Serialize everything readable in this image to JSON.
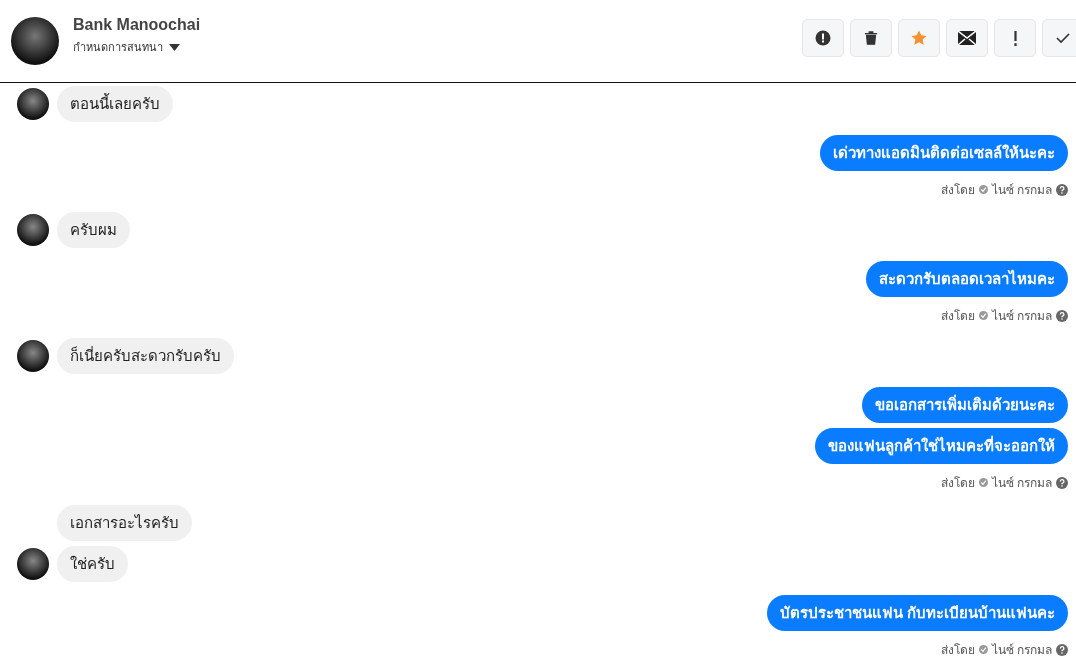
{
  "header": {
    "name": "Bank Manoochai",
    "menu_label": "กำหนดการสนทนา",
    "starred": true
  },
  "messages": [
    {
      "kind": "incoming",
      "bubbles": [
        "ตอนนี้เลยครับ"
      ]
    },
    {
      "kind": "outgoing",
      "bubbles": [
        "เด่วทางแอดมินติดต่อเซลล์ให้นะคะ"
      ],
      "sent_prefix": "ส่งโดย",
      "sender": "ไนซ์ กรกมล"
    },
    {
      "kind": "incoming",
      "bubbles": [
        "ครับผม"
      ]
    },
    {
      "kind": "outgoing",
      "bubbles": [
        "สะดวกรับตลอดเวลาไหมคะ"
      ],
      "sent_prefix": "ส่งโดย",
      "sender": "ไนซ์ กรกมล"
    },
    {
      "kind": "incoming",
      "bubbles": [
        "ก็เนี่ยครับสะดวกรับครับ"
      ]
    },
    {
      "kind": "outgoing",
      "bubbles": [
        "ขอเอกสารเพิ่มเติมด้วยนะคะ",
        "ของแฟนลูกค้าใช่ไหมคะที่จะออกให้"
      ],
      "sent_prefix": "ส่งโดย",
      "sender": "ไนซ์ กรกมล"
    },
    {
      "kind": "incoming",
      "bubbles": [
        "เอกสารอะไรครับ",
        "ใช่ครับ"
      ]
    },
    {
      "kind": "outgoing",
      "bubbles": [
        "บัตรประชาชนแฟน กับทะเบียนบ้านแฟนคะ"
      ],
      "sent_prefix": "ส่งโดย",
      "sender": "ไนซ์ กรกมล"
    }
  ]
}
